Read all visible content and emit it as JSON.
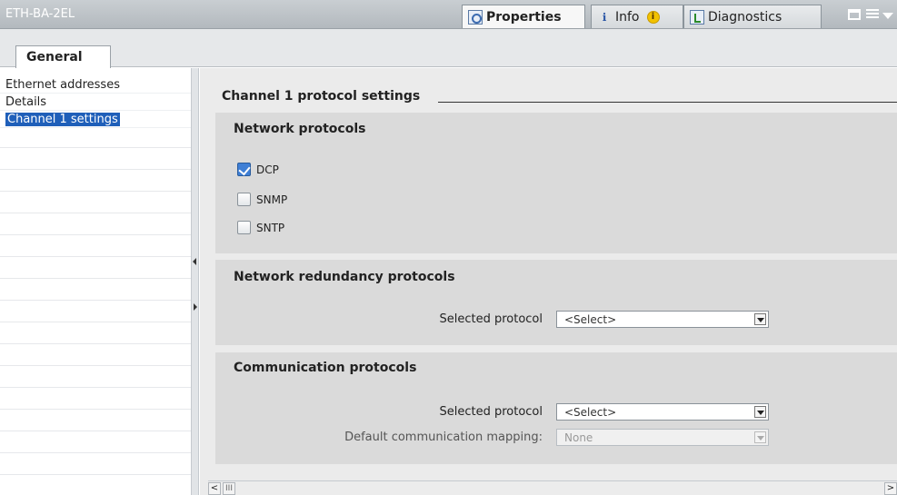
{
  "window": {
    "title": "ETH-BA-2EL",
    "tabs": [
      {
        "label": "Properties",
        "icon": "properties-icon"
      },
      {
        "label": "Info",
        "icon": "info-icon"
      },
      {
        "label": "Diagnostics",
        "icon": "diagnostics-icon"
      }
    ],
    "info_badge": "i"
  },
  "subtabs": {
    "general": "General"
  },
  "nav": {
    "items": [
      {
        "label": "Ethernet addresses",
        "selected": false
      },
      {
        "label": "Details",
        "selected": false
      },
      {
        "label": "Channel 1 settings",
        "selected": true
      }
    ]
  },
  "main": {
    "section_title": "Channel 1 protocol settings",
    "network_protocols": {
      "title": "Network protocols",
      "options": [
        {
          "label": "DCP",
          "checked": true
        },
        {
          "label": "SNMP",
          "checked": false
        },
        {
          "label": "SNTP",
          "checked": false
        }
      ]
    },
    "redundancy": {
      "title": "Network redundancy protocols",
      "selected_protocol_label": "Selected protocol",
      "selected_protocol_value": "<Select>"
    },
    "communication": {
      "title": "Communication protocols",
      "selected_protocol_label": "Selected protocol",
      "selected_protocol_value": "<Select>",
      "mapping_label": "Default communication mapping:",
      "mapping_value": "None"
    }
  },
  "scrollbar": {
    "left_arrow": "<",
    "thumb": "III",
    "right_arrow": ">"
  }
}
